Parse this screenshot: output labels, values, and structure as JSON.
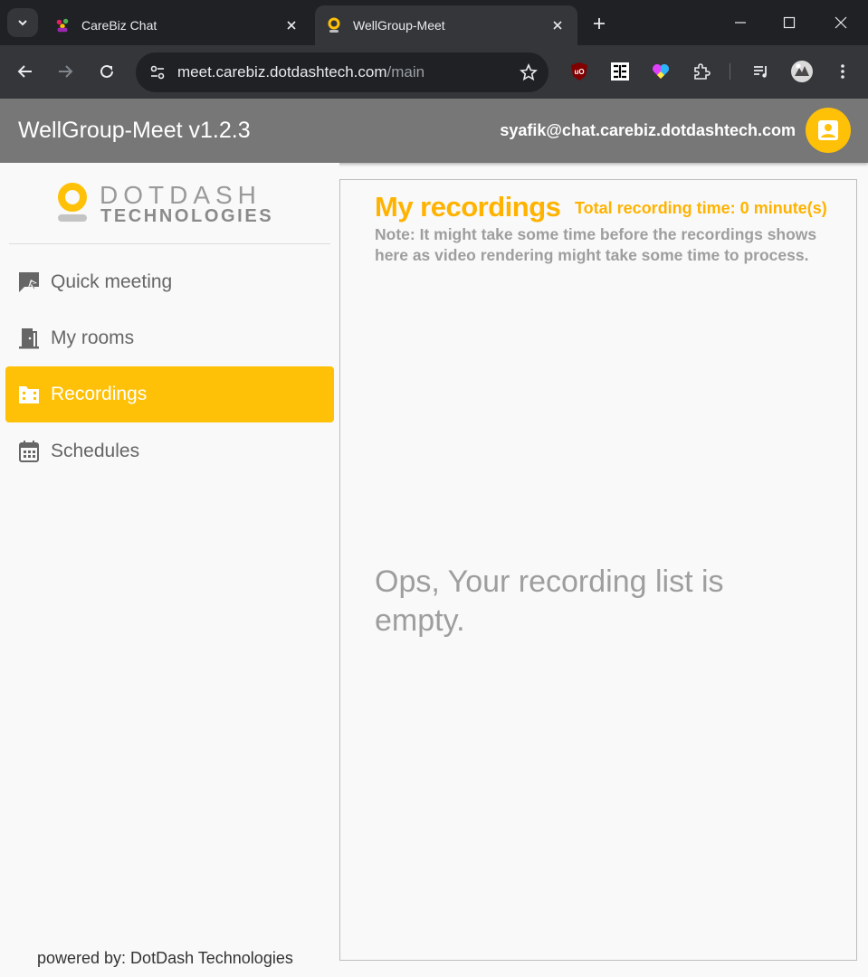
{
  "browser": {
    "tabs": [
      {
        "title": "CareBiz Chat",
        "active": false
      },
      {
        "title": "WellGroup-Meet",
        "active": true
      }
    ],
    "url_host": "meet.carebiz.dotdashtech.com",
    "url_path": "/main"
  },
  "header": {
    "app_title": "WellGroup-Meet v1.2.3",
    "user_email": "syafik@chat.carebiz.dotdashtech.com"
  },
  "sidebar": {
    "logo": {
      "top": "DOTDASH",
      "bottom": "TECHNOLOGIES"
    },
    "items": [
      {
        "label": "Quick meeting",
        "icon": "quick-meeting-icon",
        "active": false
      },
      {
        "label": "My rooms",
        "icon": "door-icon",
        "active": false
      },
      {
        "label": "Recordings",
        "icon": "video-folder-icon",
        "active": true
      },
      {
        "label": "Schedules",
        "icon": "calendar-icon",
        "active": false
      }
    ],
    "footer": "powered by: DotDash Technologies"
  },
  "main": {
    "title": "My recordings",
    "total_time": "Total recording time: 0 minute(s)",
    "note": "Note: It might take some time before the recordings shows here as video rendering might take some time to process.",
    "empty_message": "Ops, Your recording list is empty."
  },
  "colors": {
    "accent": "#ffc107",
    "header_bg": "#777777",
    "title_color": "#ffb300"
  }
}
